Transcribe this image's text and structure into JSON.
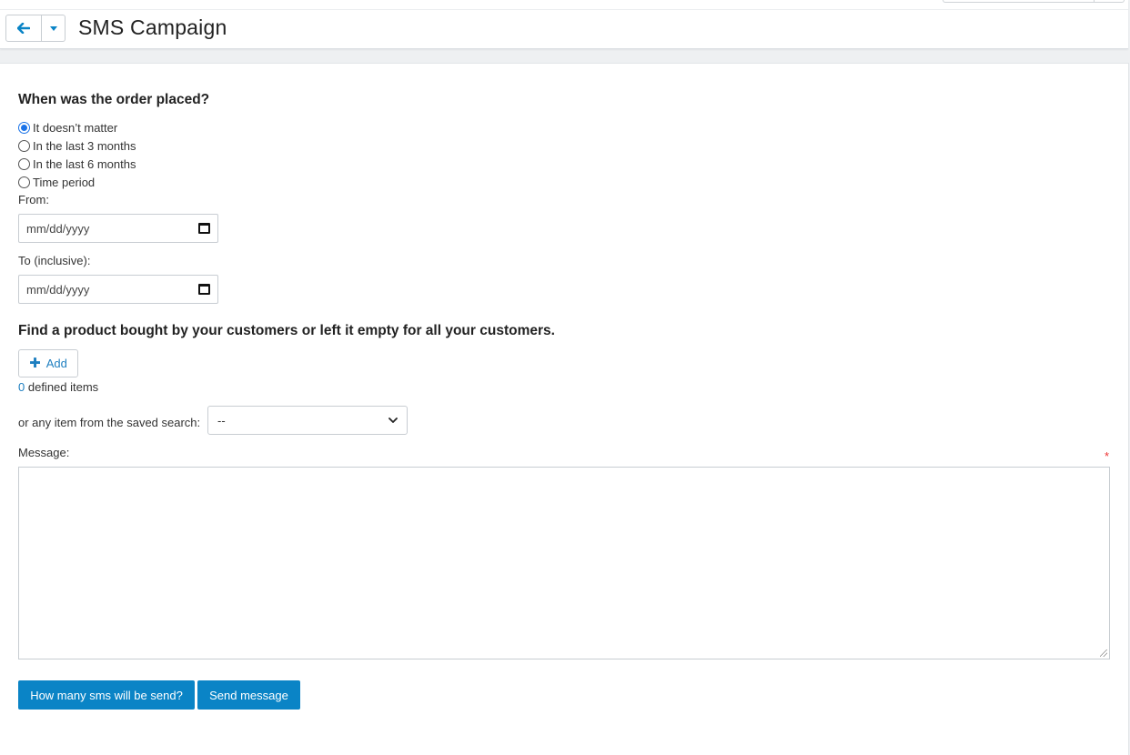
{
  "header": {
    "title": "SMS Campaign",
    "back_icon": "arrow-left-icon",
    "dropdown_icon": "caret-down-icon",
    "accent_color": "#0a84c6"
  },
  "order_section": {
    "heading": "When was the order placed?",
    "options": [
      {
        "label": "It doesn’t matter",
        "checked": true
      },
      {
        "label": "In the last 3 months",
        "checked": false
      },
      {
        "label": "In the last 6 months",
        "checked": false
      },
      {
        "label": "Time period",
        "checked": false
      }
    ],
    "from_label": "From:",
    "from_placeholder": "mm/dd/yyyy",
    "to_label": "To (inclusive):",
    "to_placeholder": "mm/dd/yyyy"
  },
  "product_section": {
    "heading": "Find a product bought by your customers or left it empty for all your customers.",
    "add_label": "Add",
    "defined_count": "0",
    "defined_text": "defined items",
    "saved_search_label": "or any item from the saved search:",
    "saved_search_value": "--"
  },
  "message_section": {
    "label": "Message:",
    "required_mark": "*",
    "value": ""
  },
  "actions": {
    "count_label": "How many sms will be send?",
    "send_label": "Send message"
  }
}
